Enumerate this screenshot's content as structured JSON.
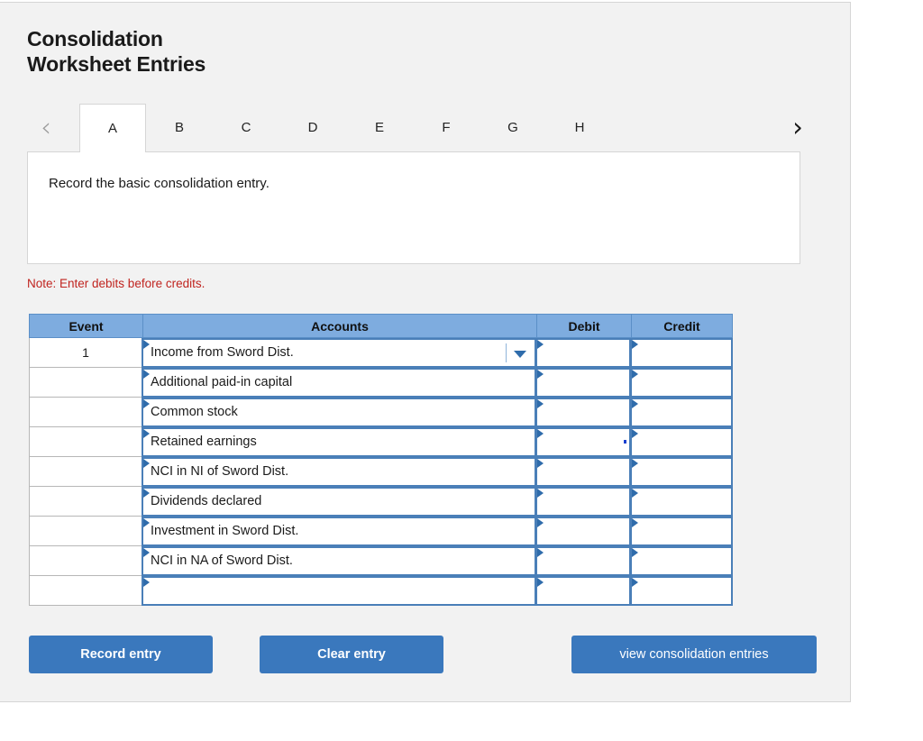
{
  "title": "Consolidation\nWorksheet Entries",
  "tabs": {
    "prev_icon": "chevron-left-icon",
    "next_icon": "chevron-right-icon",
    "items": [
      {
        "label": "A",
        "active": true,
        "width": 74
      },
      {
        "label": "B",
        "active": false,
        "width": 74
      },
      {
        "label": "C",
        "active": false,
        "width": 74
      },
      {
        "label": "D",
        "active": false,
        "width": 74
      },
      {
        "label": "E",
        "active": false,
        "width": 74
      },
      {
        "label": "F",
        "active": false,
        "width": 74
      },
      {
        "label": "G",
        "active": false,
        "width": 74
      },
      {
        "label": "H",
        "active": false,
        "width": 74
      }
    ]
  },
  "description": "Record the basic consolidation entry.",
  "note": "Note: Enter debits before credits.",
  "table": {
    "headers": [
      "Event",
      "Accounts",
      "Debit",
      "Credit"
    ],
    "rows": [
      {
        "event": "1",
        "account": "Income from Sword Dist.",
        "debit": "",
        "credit": "",
        "dropdown": true,
        "caret": ""
      },
      {
        "event": "",
        "account": "Additional paid-in capital",
        "debit": "",
        "credit": "",
        "dropdown": false,
        "caret": ""
      },
      {
        "event": "",
        "account": "Common stock",
        "debit": "",
        "credit": "",
        "dropdown": false,
        "caret": ""
      },
      {
        "event": "",
        "account": "Retained earnings",
        "debit": "",
        "credit": "",
        "dropdown": false,
        "caret": "debit"
      },
      {
        "event": "",
        "account": "NCI in NI of Sword Dist.",
        "debit": "",
        "credit": "",
        "dropdown": false,
        "caret": ""
      },
      {
        "event": "",
        "account": "Dividends declared",
        "debit": "",
        "credit": "",
        "dropdown": false,
        "caret": ""
      },
      {
        "event": "",
        "account": "Investment in Sword Dist.",
        "debit": "",
        "credit": "",
        "dropdown": false,
        "caret": ""
      },
      {
        "event": "",
        "account": "NCI in NA of Sword Dist.",
        "debit": "",
        "credit": "",
        "dropdown": false,
        "caret": ""
      },
      {
        "event": "",
        "account": "",
        "debit": "",
        "credit": "",
        "dropdown": false,
        "caret": ""
      }
    ]
  },
  "buttons": {
    "record": "Record entry",
    "clear": "Clear entry",
    "view": "view consolidation entries"
  },
  "colors": {
    "header_blue": "#7eacdf",
    "field_border_blue": "#4a7fb8",
    "button_blue": "#3a78bd",
    "note_red": "#c0241f",
    "panel_bg": "#f2f2f2"
  }
}
